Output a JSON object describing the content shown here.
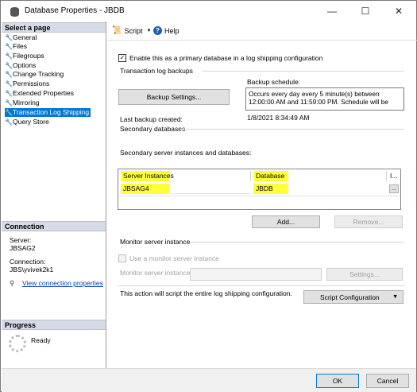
{
  "window": {
    "title": "Database Properties - JBDB",
    "minimize_glyph": "—",
    "maximize_glyph": "☐",
    "close_glyph": "✕"
  },
  "left_pane": {
    "select_page_header": "Select a page",
    "pages": [
      {
        "label": "General",
        "selected": false
      },
      {
        "label": "Files",
        "selected": false
      },
      {
        "label": "Filegroups",
        "selected": false
      },
      {
        "label": "Options",
        "selected": false
      },
      {
        "label": "Change Tracking",
        "selected": false
      },
      {
        "label": "Permissions",
        "selected": false
      },
      {
        "label": "Extended Properties",
        "selected": false
      },
      {
        "label": "Mirroring",
        "selected": false
      },
      {
        "label": "Transaction Log Shipping",
        "selected": true
      },
      {
        "label": "Query Store",
        "selected": false
      }
    ],
    "connection_header": "Connection",
    "server_label": "Server:",
    "server_value": "JBSAG2",
    "connection_label": "Connection:",
    "connection_value": "JBS\\yvivek2k1",
    "view_connection_link": "View connection properties",
    "progress_header": "Progress",
    "progress_status": "Ready"
  },
  "toolbar": {
    "script_label": "Script",
    "help_label": "Help",
    "help_glyph": "?"
  },
  "main": {
    "enable_primary_checkbox": {
      "label": "Enable this as a primary database in a log shipping configuration",
      "checked": true,
      "glyph": "✓"
    },
    "transaction_log_backups_label": "Transaction log backups",
    "backup_settings_button": "Backup Settings...",
    "backup_schedule_label": "Backup schedule:",
    "backup_schedule_text": "Occurs every day every 5 minute(s) between 12:00:00 AM and 11:59:00 PM. Schedule will be",
    "last_backup_label": "Last backup created:",
    "last_backup_value": "1/8/2021 8:34:49 AM",
    "secondary_databases_label": "Secondary databases",
    "secondary_instances_label": "Secondary server instances and databases:",
    "grid": {
      "columns": [
        "Server Instances",
        "Database",
        "I..."
      ],
      "rows": [
        {
          "server_instance": "JBSAG4",
          "database": "JBDB",
          "ellipsis": "..."
        }
      ]
    },
    "add_button": "Add...",
    "remove_button": "Remove...",
    "monitor_server_instance_label": "Monitor server instance",
    "use_monitor_checkbox": {
      "label": "Use a monitor server instance",
      "checked": false
    },
    "monitor_server_instance_field_label": "Monitor server instance",
    "monitor_settings_button": "Settings...",
    "script_info_text": "This action will script the entire log shipping configuration.",
    "script_configuration_button": "Script Configuration",
    "dropdown_glyph": "▼"
  },
  "footer": {
    "ok_button": "OK",
    "cancel_button": "Cancel"
  }
}
